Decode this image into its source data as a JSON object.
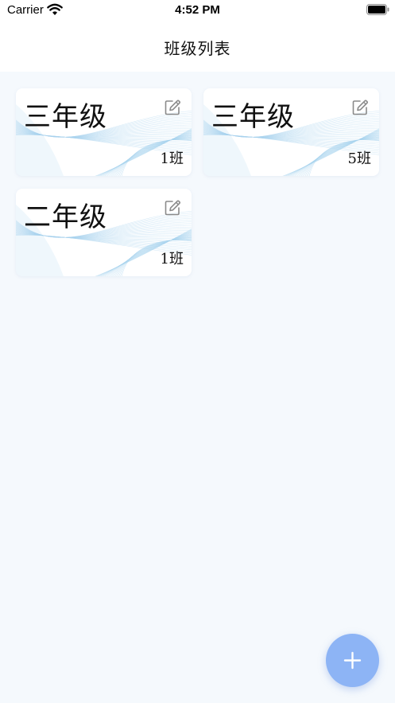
{
  "status_bar": {
    "carrier": "Carrier",
    "time": "4:52 PM"
  },
  "nav": {
    "title": "班级列表"
  },
  "classes": [
    {
      "grade": "三年级",
      "class": "1班"
    },
    {
      "grade": "三年级",
      "class": "5班"
    },
    {
      "grade": "二年级",
      "class": "1班"
    }
  ],
  "icons": {
    "edit": "edit-icon",
    "add": "plus-icon"
  },
  "colors": {
    "background": "#f5f9fd",
    "card": "#ffffff",
    "wave": "#a9d3ee",
    "fab": "#8db4f5"
  }
}
